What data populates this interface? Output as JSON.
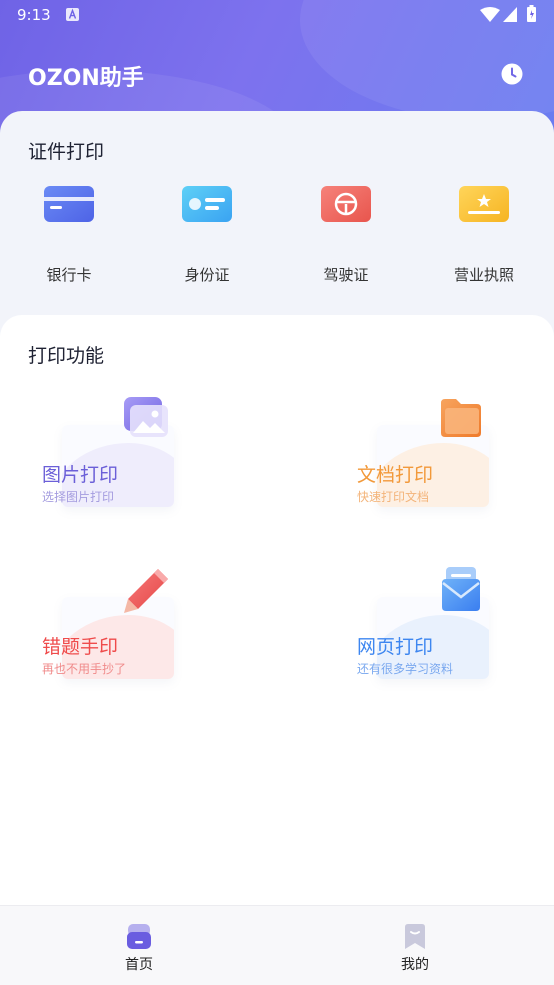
{
  "status_bar": {
    "time": "9:13"
  },
  "header": {
    "title": "OZON助手"
  },
  "certificates": {
    "title": "证件打印",
    "items": [
      {
        "label": "银行卡"
      },
      {
        "label": "身份证"
      },
      {
        "label": "驾驶证"
      },
      {
        "label": "营业执照"
      }
    ]
  },
  "functions": {
    "title": "打印功能",
    "cards": [
      {
        "title": "图片打印",
        "subtitle": "选择图片打印",
        "color": "#6b5fd8",
        "sub_color": "#a49cdf"
      },
      {
        "title": "文档打印",
        "subtitle": "快速打印文档",
        "color": "#f2993a",
        "sub_color": "#f3b47a"
      },
      {
        "title": "错题手印",
        "subtitle": "再也不用手抄了",
        "color": "#ef4b4b",
        "sub_color": "#f08a8a"
      },
      {
        "title": "网页打印",
        "subtitle": "还有很多学习资料",
        "color": "#3d86f0",
        "sub_color": "#7aa8ef"
      }
    ]
  },
  "bottom_nav": {
    "items": [
      {
        "label": "首页",
        "active": true
      },
      {
        "label": "我的",
        "active": false
      }
    ]
  }
}
